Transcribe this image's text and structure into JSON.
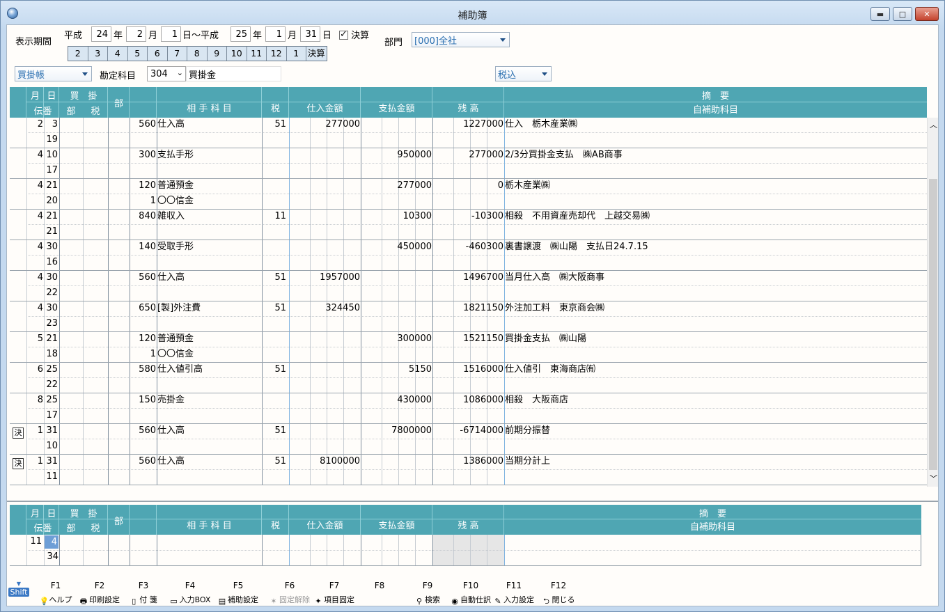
{
  "window": {
    "title": "補助簿"
  },
  "period": {
    "label": "表示期間",
    "era_from": "平成",
    "year_from": "24",
    "year_unit": "年",
    "month_from": "2",
    "month_unit": "月",
    "day_from": "1",
    "day_unit_tilde": "日～平成",
    "year_to": "25",
    "month_to": "1",
    "day_to": "31",
    "day_unit": "日",
    "kessan_label": "決算",
    "months": [
      "2",
      "3",
      "4",
      "5",
      "6",
      "7",
      "8",
      "9",
      "10",
      "11",
      "12",
      "1",
      "決算"
    ]
  },
  "department": {
    "label": "部門",
    "value": "[000]全社"
  },
  "book": {
    "type": "買掛帳",
    "account_label": "勘定科目",
    "account_code": "304",
    "account_name": "買掛金",
    "tax_mode": "税込"
  },
  "headers": {
    "month": "月",
    "day": "日",
    "kaikake": "買　掛",
    "denban": "伝番",
    "bu": "部",
    "zei": "税",
    "bu2": "部",
    "aite": "相 手 科 目",
    "tax": "税",
    "shiire": "仕入金額",
    "shiharai": "支払金額",
    "zandaka": "残 高",
    "tekiyo": "摘　要",
    "subaccount": "自補助科目"
  },
  "rows": [
    {
      "k": "",
      "m": "2",
      "d": "3",
      "no": "19",
      "code": "560",
      "acct": "仕入高",
      "code2": "",
      "acct2": "",
      "tax": "51",
      "shiire": "277000",
      "shiharai": "",
      "bal": "1227000",
      "memo": "仕入　栃木産業㈱"
    },
    {
      "k": "",
      "m": "4",
      "d": "10",
      "no": "17",
      "code": "300",
      "acct": "支払手形",
      "code2": "",
      "acct2": "",
      "tax": "",
      "shiire": "",
      "shiharai": "950000",
      "bal": "277000",
      "memo": "2/3分買掛金支払　㈱AB商事"
    },
    {
      "k": "",
      "m": "4",
      "d": "21",
      "no": "20",
      "code": "120",
      "acct": "普通預金",
      "code2": "1",
      "acct2": "〇〇信金",
      "tax": "",
      "shiire": "",
      "shiharai": "277000",
      "bal": "0",
      "memo": "栃木産業㈱"
    },
    {
      "k": "",
      "m": "4",
      "d": "21",
      "no": "21",
      "code": "840",
      "acct": "雑収入",
      "code2": "",
      "acct2": "",
      "tax": "11",
      "shiire": "",
      "shiharai": "10300",
      "bal": "-10300",
      "memo": "相殺　不用資産売却代　上越交易㈱"
    },
    {
      "k": "",
      "m": "4",
      "d": "30",
      "no": "16",
      "code": "140",
      "acct": "受取手形",
      "code2": "",
      "acct2": "",
      "tax": "",
      "shiire": "",
      "shiharai": "450000",
      "bal": "-460300",
      "memo": "裏書譲渡　㈱山陽　支払日24.7.15"
    },
    {
      "k": "",
      "m": "4",
      "d": "30",
      "no": "22",
      "code": "560",
      "acct": "仕入高",
      "code2": "",
      "acct2": "",
      "tax": "51",
      "shiire": "1957000",
      "shiharai": "",
      "bal": "1496700",
      "memo": "当月仕入高　㈱大阪商事"
    },
    {
      "k": "",
      "m": "4",
      "d": "30",
      "no": "23",
      "code": "650",
      "acct": "[製]外注費",
      "code2": "",
      "acct2": "",
      "tax": "51",
      "shiire": "324450",
      "shiharai": "",
      "bal": "1821150",
      "memo": "外注加工料　東京商会㈱"
    },
    {
      "k": "",
      "m": "5",
      "d": "21",
      "no": "18",
      "code": "120",
      "acct": "普通預金",
      "code2": "1",
      "acct2": "〇〇信金",
      "tax": "",
      "shiire": "",
      "shiharai": "300000",
      "bal": "1521150",
      "memo": "買掛金支払　㈱山陽"
    },
    {
      "k": "",
      "m": "6",
      "d": "25",
      "no": "22",
      "code": "580",
      "acct": "仕入値引高",
      "code2": "",
      "acct2": "",
      "tax": "51",
      "shiire": "",
      "shiharai": "5150",
      "bal": "1516000",
      "memo": "仕入値引　東海商店㈲"
    },
    {
      "k": "",
      "m": "8",
      "d": "25",
      "no": "17",
      "code": "150",
      "acct": "売掛金",
      "code2": "",
      "acct2": "",
      "tax": "",
      "shiire": "",
      "shiharai": "430000",
      "bal": "1086000",
      "memo": "相殺　大阪商店"
    },
    {
      "k": "決",
      "m": "1",
      "d": "31",
      "no": "10",
      "code": "560",
      "acct": "仕入高",
      "code2": "",
      "acct2": "",
      "tax": "51",
      "shiire": "",
      "shiharai": "7800000",
      "bal": "-6714000",
      "memo": "前期分振替"
    },
    {
      "k": "決",
      "m": "1",
      "d": "31",
      "no": "11",
      "code": "560",
      "acct": "仕入高",
      "code2": "",
      "acct2": "",
      "tax": "51",
      "shiire": "8100000",
      "shiharai": "",
      "bal": "1386000",
      "memo": "当期分計上"
    }
  ],
  "entry": {
    "month": "11",
    "day": "4",
    "no": "34"
  },
  "fkeys": [
    {
      "key": "F1",
      "label": "ヘルプ"
    },
    {
      "key": "F2",
      "label": "印刷設定"
    },
    {
      "key": "F3",
      "label": "付 箋"
    },
    {
      "key": "F4",
      "label": "入力BOX"
    },
    {
      "key": "F5",
      "label": "補助設定"
    },
    {
      "key": "F6",
      "label": "固定解除"
    },
    {
      "key": "F7",
      "label": "項目固定"
    },
    {
      "key": "F8",
      "label": ""
    },
    {
      "key": "F9",
      "label": "検索"
    },
    {
      "key": "F10",
      "label": "自動仕訳"
    },
    {
      "key": "F11",
      "label": "入力設定"
    },
    {
      "key": "F12",
      "label": "閉じる"
    }
  ],
  "shift_label": "Shift"
}
